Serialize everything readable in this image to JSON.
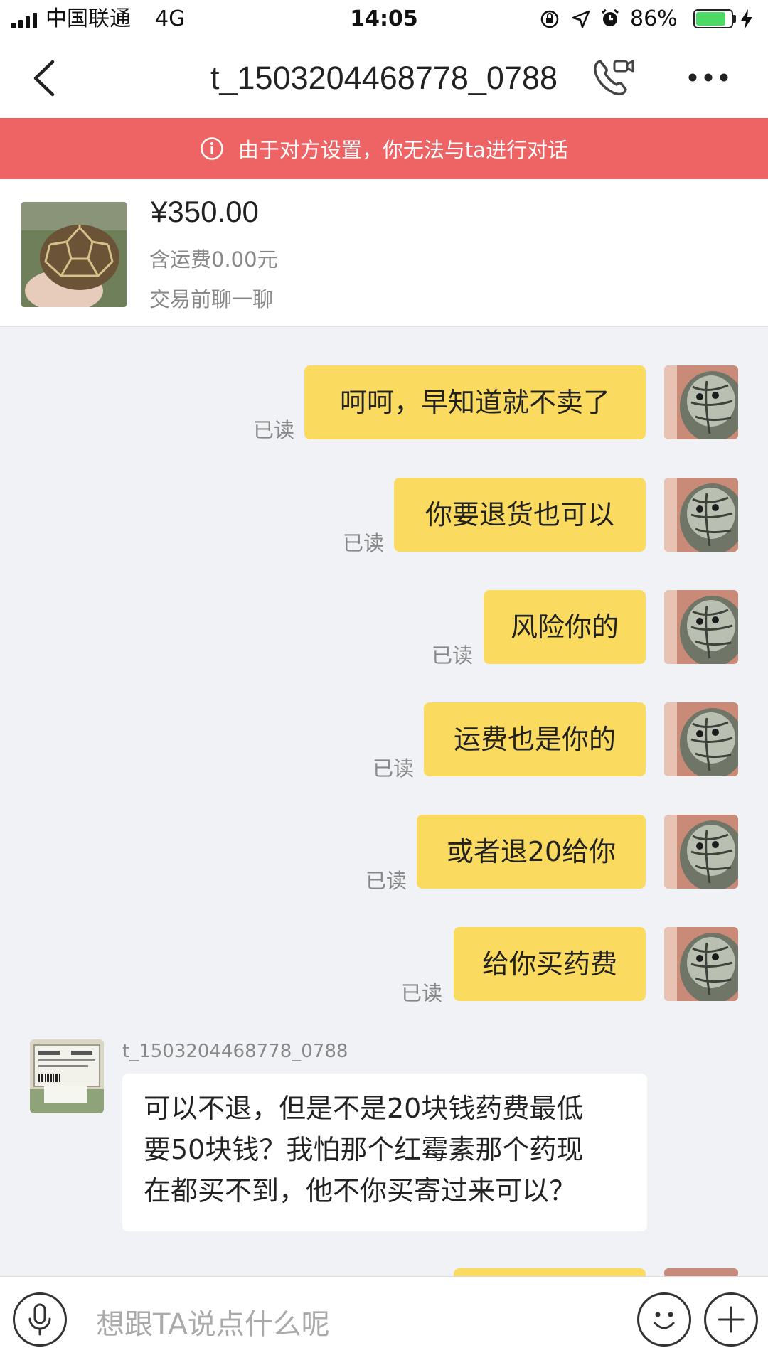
{
  "status_bar": {
    "carrier": "中国联通",
    "network": "4G",
    "time": "14:05",
    "battery_pct": "86%",
    "battery_level": 0.86,
    "battery_color": "#4cd964"
  },
  "nav": {
    "title": "t_1503204468778_0788",
    "icons": [
      "back-icon",
      "video-call-icon",
      "more-icon"
    ]
  },
  "banner": {
    "text": "由于对方设置，你无法与ta进行对话",
    "bg_color": "#ee6363",
    "icon": "info-icon"
  },
  "product": {
    "price": "¥350.00",
    "shipping": "含运费0.00元",
    "prompt": "交易前聊一聊"
  },
  "messages": {
    "read_label": "已读",
    "outgoing": [
      "呵呵，早知道就不卖了",
      "你要退货也可以",
      "风险你的",
      "运费也是你的",
      "或者退20给你",
      "给你买药费"
    ],
    "outgoing_bubble_color": "#fbdb5f",
    "incoming": {
      "sender": "t_1503204468778_0788",
      "lines": [
        "可以不退，但是不是20块钱药费最低",
        "要50块钱？我怕那个红霉素那个药现",
        "在都买不到，他不你买寄过来可以？"
      ]
    }
  },
  "input": {
    "placeholder": "想跟TA说点什么呢",
    "icons": [
      "microphone-icon",
      "emoji-icon",
      "plus-icon"
    ]
  }
}
